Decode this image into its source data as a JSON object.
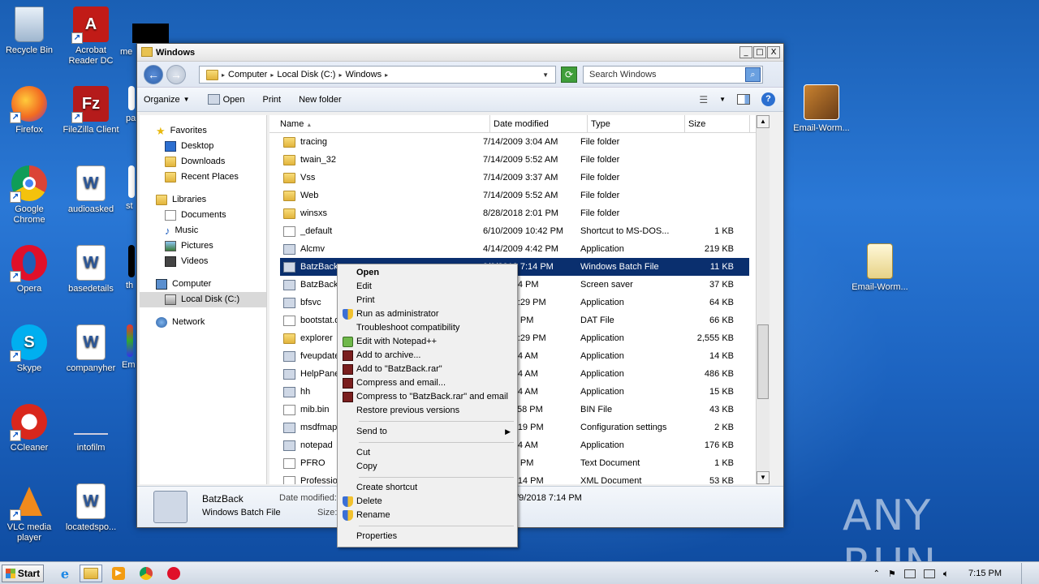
{
  "desktop": {
    "icons_left": [
      {
        "label": "Recycle Bin"
      },
      {
        "label": "Acrobat Reader DC"
      },
      {
        "label": "Firefox"
      },
      {
        "label": "FileZilla Client"
      },
      {
        "label": "Google Chrome"
      },
      {
        "label": "audioasked"
      },
      {
        "label": "Opera"
      },
      {
        "label": "basedetails"
      },
      {
        "label": "Skype"
      },
      {
        "label": "companyher"
      },
      {
        "label": "CCleaner"
      },
      {
        "label": "intofilm"
      },
      {
        "label": "VLC media player"
      },
      {
        "label": "locatedspo..."
      }
    ],
    "partial_labels": [
      "me",
      "pa",
      "st",
      "th",
      "Em"
    ],
    "icons_right": [
      {
        "label": "Email-Worm..."
      },
      {
        "label": "Email-Worm..."
      }
    ]
  },
  "window": {
    "title": "Windows",
    "title_buttons": [
      "_",
      "□",
      "X"
    ],
    "breadcrumb": [
      "Computer",
      "Local Disk (C:)",
      "Windows"
    ],
    "search_placeholder": "Search Windows",
    "toolbar": {
      "organize": "Organize",
      "open": "Open",
      "print": "Print",
      "new_folder": "New folder"
    },
    "nav": {
      "favorites": "Favorites",
      "desktop": "Desktop",
      "downloads": "Downloads",
      "recent_places": "Recent Places",
      "libraries": "Libraries",
      "documents": "Documents",
      "music": "Music",
      "pictures": "Pictures",
      "videos": "Videos",
      "computer": "Computer",
      "local_disk": "Local Disk (C:)",
      "network": "Network"
    },
    "columns": [
      "Name",
      "Date modified",
      "Type",
      "Size"
    ],
    "files": [
      {
        "name": "tracing",
        "date": "7/14/2009 3:04 AM",
        "type": "File folder",
        "size": "",
        "icon": "folder"
      },
      {
        "name": "twain_32",
        "date": "7/14/2009 5:52 AM",
        "type": "File folder",
        "size": "",
        "icon": "folder"
      },
      {
        "name": "Vss",
        "date": "7/14/2009 3:37 AM",
        "type": "File folder",
        "size": "",
        "icon": "folder"
      },
      {
        "name": "Web",
        "date": "7/14/2009 5:52 AM",
        "type": "File folder",
        "size": "",
        "icon": "folder"
      },
      {
        "name": "winsxs",
        "date": "8/28/2018 2:01 PM",
        "type": "File folder",
        "size": "",
        "icon": "folder"
      },
      {
        "name": "_default",
        "date": "6/10/2009 10:42 PM",
        "type": "Shortcut to MS-DOS...",
        "size": "1 KB",
        "icon": "file"
      },
      {
        "name": "Alcmv",
        "date": "4/14/2009 4:42 PM",
        "type": "Application",
        "size": "219 KB",
        "icon": "app"
      },
      {
        "name": "BatzBack",
        "date": "9/9/2018 7:14 PM",
        "type": "Windows Batch File",
        "size": "11 KB",
        "icon": "app",
        "selected": true
      },
      {
        "name": "BatzBack",
        "date": "2004 1:44 PM",
        "type": "Screen saver",
        "size": "37 KB",
        "icon": "app"
      },
      {
        "name": "bfsvc",
        "date": "7/2010 9:29 PM",
        "type": "Application",
        "size": "64 KB",
        "icon": "app"
      },
      {
        "name": "bootstat.d",
        "date": "018 4:12 PM",
        "type": "DAT File",
        "size": "66 KB",
        "icon": "file"
      },
      {
        "name": "explorer",
        "date": "7/2010 9:29 PM",
        "type": "Application",
        "size": "2,555 KB",
        "icon": "folder"
      },
      {
        "name": "fveupdate",
        "date": "2009 2:14 AM",
        "type": "Application",
        "size": "14 KB",
        "icon": "app"
      },
      {
        "name": "HelpPane",
        "date": "2009 2:14 AM",
        "type": "Application",
        "size": "486 KB",
        "icon": "app"
      },
      {
        "name": "hh",
        "date": "2009 2:14 AM",
        "type": "Application",
        "size": "15 KB",
        "icon": "app"
      },
      {
        "name": "mib.bin",
        "date": "2009 11:58 PM",
        "type": "BIN File",
        "size": "43 KB",
        "icon": "file"
      },
      {
        "name": "msdfmap",
        "date": "2009 10:19 PM",
        "type": "Configuration settings",
        "size": "2 KB",
        "icon": "app"
      },
      {
        "name": "notepad",
        "date": "2009 2:14 AM",
        "type": "Application",
        "size": "176 KB",
        "icon": "app"
      },
      {
        "name": "PFRO",
        "date": "018 3:55 PM",
        "type": "Text Document",
        "size": "1 KB",
        "icon": "file"
      },
      {
        "name": "Profession",
        "date": "2009 10:14 PM",
        "type": "XML Document",
        "size": "53 KB",
        "icon": "file"
      }
    ],
    "details": {
      "name": "BatzBack",
      "type": "Windows Batch File",
      "date_label": "Date modified:",
      "date_value": "9/9/2018 7:14 PM",
      "size_label": "Size:"
    }
  },
  "context_menu": {
    "items": [
      {
        "label": "Open",
        "bold": true
      },
      {
        "label": "Edit"
      },
      {
        "label": "Print"
      },
      {
        "label": "Run as administrator",
        "icon": "shield"
      },
      {
        "label": "Troubleshoot compatibility"
      },
      {
        "label": "Edit with Notepad++",
        "icon": "npp"
      },
      {
        "label": "Add to archive...",
        "icon": "rar"
      },
      {
        "label": "Add to \"BatzBack.rar\"",
        "icon": "rar"
      },
      {
        "label": "Compress and email...",
        "icon": "rar"
      },
      {
        "label": "Compress to \"BatzBack.rar\" and email",
        "icon": "rar"
      },
      {
        "label": "Restore previous versions"
      },
      {
        "sep": true
      },
      {
        "label": "Send to",
        "submenu": true
      },
      {
        "sep": true
      },
      {
        "label": "Cut"
      },
      {
        "label": "Copy"
      },
      {
        "sep": true
      },
      {
        "label": "Create shortcut"
      },
      {
        "label": "Delete",
        "icon": "shield"
      },
      {
        "label": "Rename",
        "icon": "shield"
      },
      {
        "sep": true
      },
      {
        "label": "Properties"
      }
    ]
  },
  "taskbar": {
    "start_label": "Start",
    "clock": "7:15 PM"
  },
  "watermark": "ANY RUN"
}
